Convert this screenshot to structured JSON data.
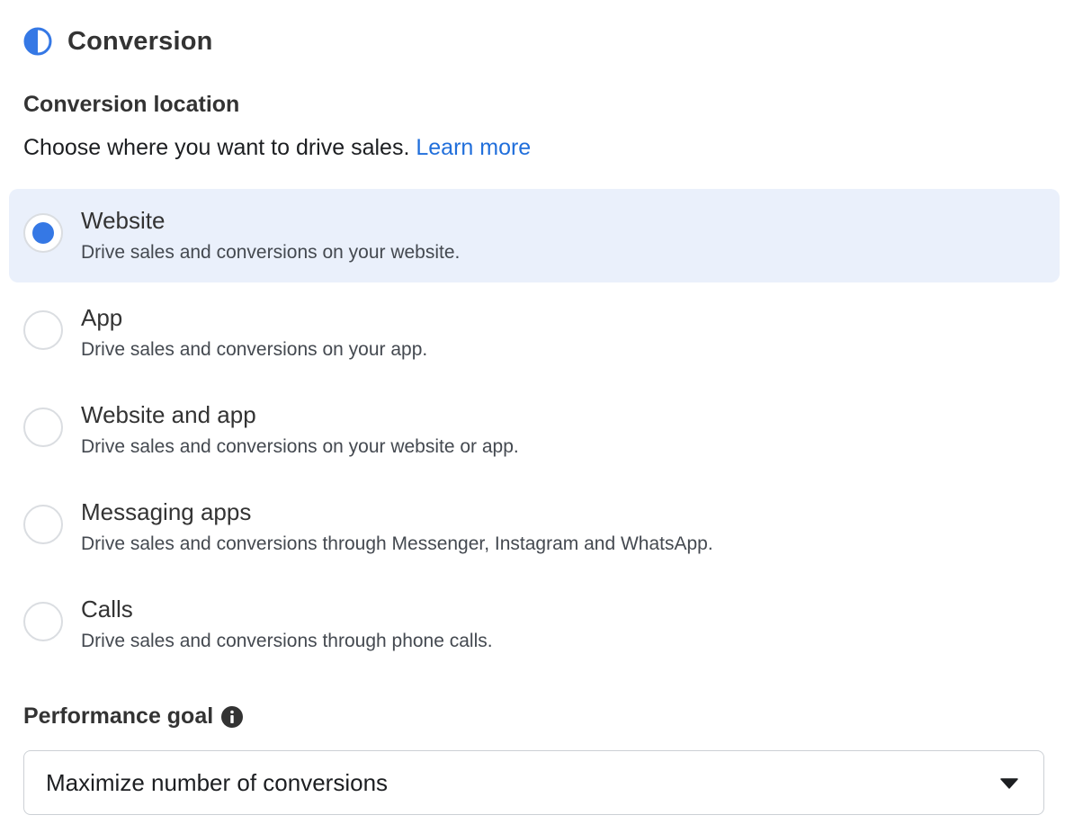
{
  "header": {
    "title": "Conversion",
    "icon": "half-circle-icon",
    "accent": "#3578e5"
  },
  "conversion_location": {
    "label": "Conversion location",
    "description": "Choose where you want to drive sales.",
    "learn_more": "Learn more",
    "options": [
      {
        "title": "Website",
        "description": "Drive sales and conversions on your website.",
        "selected": true
      },
      {
        "title": "App",
        "description": "Drive sales and conversions on your app.",
        "selected": false
      },
      {
        "title": "Website and app",
        "description": "Drive sales and conversions on your website or app.",
        "selected": false
      },
      {
        "title": "Messaging apps",
        "description": "Drive sales and conversions through Messenger, Instagram and WhatsApp.",
        "selected": false
      },
      {
        "title": "Calls",
        "description": "Drive sales and conversions through phone calls.",
        "selected": false
      }
    ]
  },
  "performance_goal": {
    "label": "Performance goal",
    "info_icon": "info-icon",
    "selected_value": "Maximize number of conversions",
    "dropdown_icon": "caret-down-icon"
  },
  "colors": {
    "selected_background": "#eaf0fb",
    "radio_selected": "#3578e5",
    "link": "#216fdb"
  }
}
